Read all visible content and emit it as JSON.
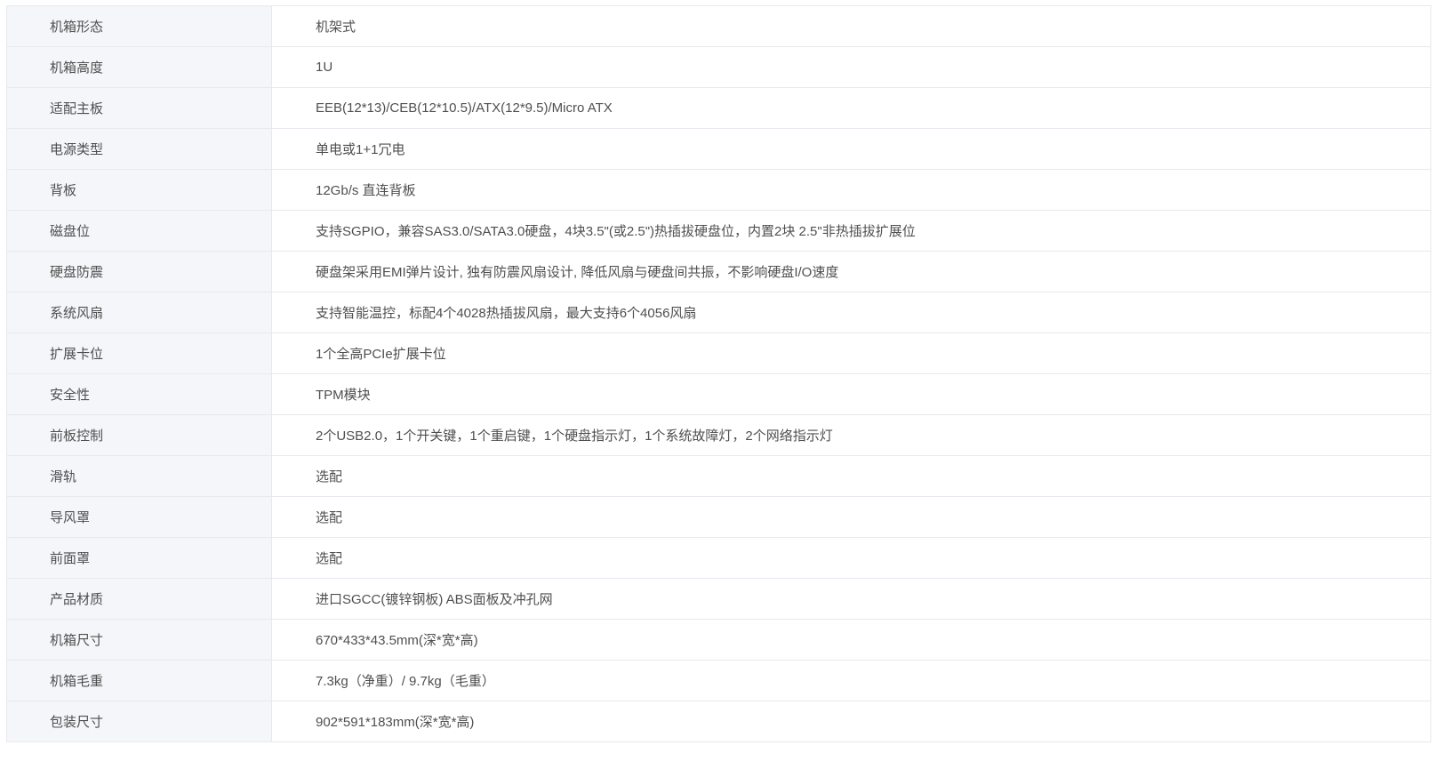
{
  "specs": [
    {
      "key": "机箱形态",
      "value": "机架式"
    },
    {
      "key": "机箱高度",
      "value": "1U"
    },
    {
      "key": "适配主板",
      "value": "EEB(12*13)/CEB(12*10.5)/ATX(12*9.5)/Micro ATX"
    },
    {
      "key": "电源类型",
      "value": "单电或1+1冗电"
    },
    {
      "key": "背板",
      "value": "12Gb/s 直连背板"
    },
    {
      "key": "磁盘位",
      "value": "支持SGPIO，兼容SAS3.0/SATA3.0硬盘，4块3.5\"(或2.5\")热插拔硬盘位，内置2块 2.5\"非热插拔扩展位"
    },
    {
      "key": "硬盘防震",
      "value": "硬盘架采用EMI弹片设计, 独有防震风扇设计, 降低风扇与硬盘间共振，不影响硬盘I/O速度"
    },
    {
      "key": "系统风扇",
      "value": "支持智能温控，标配4个4028热插拔风扇，最大支持6个4056风扇"
    },
    {
      "key": "扩展卡位",
      "value": "1个全高PCIe扩展卡位"
    },
    {
      "key": "安全性",
      "value": "TPM模块"
    },
    {
      "key": "前板控制",
      "value": "2个USB2.0，1个开关键，1个重启键，1个硬盘指示灯，1个系统故障灯，2个网络指示灯"
    },
    {
      "key": "滑轨",
      "value": "选配"
    },
    {
      "key": "导风罩",
      "value": "选配"
    },
    {
      "key": "前面罩",
      "value": "选配"
    },
    {
      "key": "产品材质",
      "value": "进口SGCC(镀锌钢板) ABS面板及冲孔网"
    },
    {
      "key": "机箱尺寸",
      "value": "670*433*43.5mm(深*宽*高)"
    },
    {
      "key": "机箱毛重",
      "value": "7.3kg（净重）/ 9.7kg（毛重）"
    },
    {
      "key": "包装尺寸",
      "value": "902*591*183mm(深*宽*高)"
    }
  ]
}
